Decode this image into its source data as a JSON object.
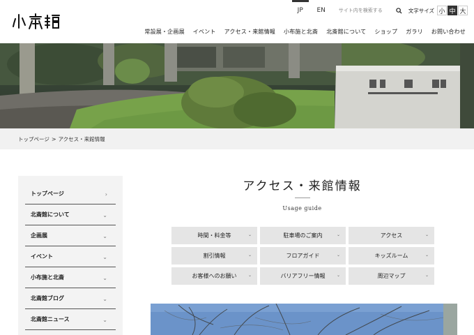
{
  "header": {
    "logo_alt": "北斎館",
    "lang": [
      {
        "label": "JP",
        "active": true
      },
      {
        "label": "EN",
        "active": false
      }
    ],
    "search": {
      "placeholder": "サイト内を検索する"
    },
    "fontsize": {
      "label": "文字サイズ",
      "options": [
        {
          "label": "小",
          "active": false
        },
        {
          "label": "中",
          "active": true
        },
        {
          "label": "大",
          "active": false
        }
      ]
    },
    "nav": [
      "常設展・企画展",
      "イベント",
      "アクセス・来館情報",
      "小布施と北斎",
      "北斎館について",
      "ショップ",
      "ガラリ",
      "お問い合わせ"
    ]
  },
  "breadcrumb": {
    "items": [
      "トップページ",
      "アクセス・来館情報"
    ],
    "separator": ">"
  },
  "sidebar": {
    "items": [
      {
        "label": "トップページ",
        "chevron": "›"
      },
      {
        "label": "北斎館について",
        "chevron": "⌄"
      },
      {
        "label": "企画展",
        "chevron": "⌄"
      },
      {
        "label": "イベント",
        "chevron": "⌄"
      },
      {
        "label": "小布施と北斎",
        "chevron": "⌄"
      },
      {
        "label": "北斎館ブログ",
        "chevron": "⌄"
      },
      {
        "label": "北斎館ニュース",
        "chevron": "⌄"
      }
    ]
  },
  "main": {
    "title": "アクセス・来館情報",
    "subtitle": "Usage guide",
    "guide_buttons": [
      "時間・料金等",
      "駐車場のご案内",
      "アクセス",
      "割引情報",
      "フロアガイド",
      "キッズルーム",
      "お客様へのお願い",
      "バリアフリー情報",
      "周辺マップ"
    ]
  },
  "colors": {
    "text": "#222222",
    "button_bg": "#e5e5e5",
    "sidebar_bg": "#f3f3f3",
    "breadcrumb_bg": "#f1f1f1",
    "active_dark": "#333333"
  }
}
